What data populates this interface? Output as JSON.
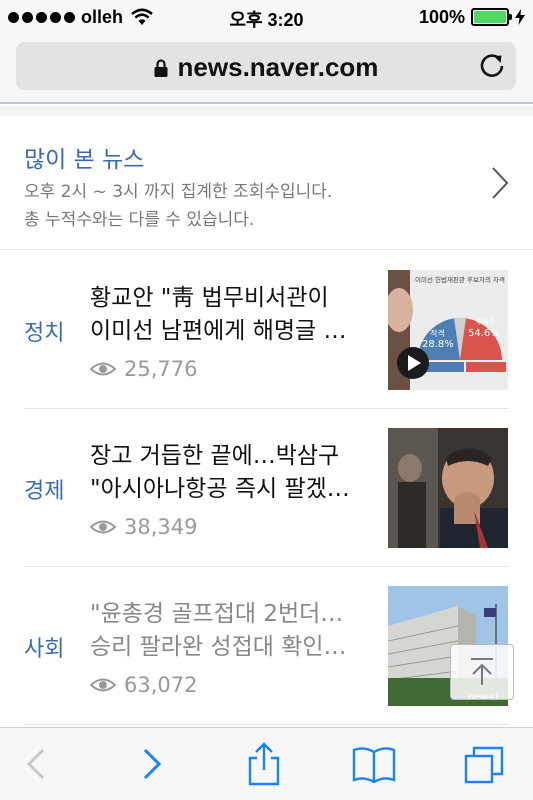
{
  "status_bar": {
    "carrier": "olleh",
    "time": "오후 3:20",
    "battery_percent": "100%",
    "battery_level": 1.0,
    "battery_color": "#4cd964"
  },
  "browser": {
    "url": "news.naver.com",
    "icons": [
      "lock-icon",
      "reload-icon"
    ]
  },
  "section": {
    "title": "많이 본 뉴스",
    "desc_line1": "오후 2시 ~ 3시 까지 집계한 조회수입니다.",
    "desc_line2": "총 누적수와는 다를 수 있습니다."
  },
  "articles": [
    {
      "category": "정치",
      "line1": "황교안 \"靑 법무비서관이",
      "line2": "이미선 남편에게 해명글 …",
      "views": "25,776",
      "thumb": {
        "chart_title": "이미선 헌법재판관 후보자의 자격",
        "left_label": "적격",
        "left_value": "28.8%",
        "right_label": "부적격",
        "right_value": "54.6%"
      }
    },
    {
      "category": "경제",
      "line1": "장고 거듭한 끝에…박삼구",
      "line2": "\"아시아나항공 즉시 팔겠…",
      "views": "38,349"
    },
    {
      "category": "사회",
      "line1": "\"윤총경 골프접대 2번더…",
      "line2": "승리 팔라완 성접대 확인…",
      "views": "63,072",
      "thumb": {
        "watermark": "news1"
      }
    }
  ],
  "colors": {
    "accent_blue": "#3b6ab3",
    "ios_blue": "#1a82fb",
    "disabled_gray": "#c7c7cc"
  },
  "toolbar": {
    "icons": [
      "back-icon",
      "forward-icon",
      "share-icon",
      "bookmarks-icon",
      "tabs-icon"
    ]
  }
}
